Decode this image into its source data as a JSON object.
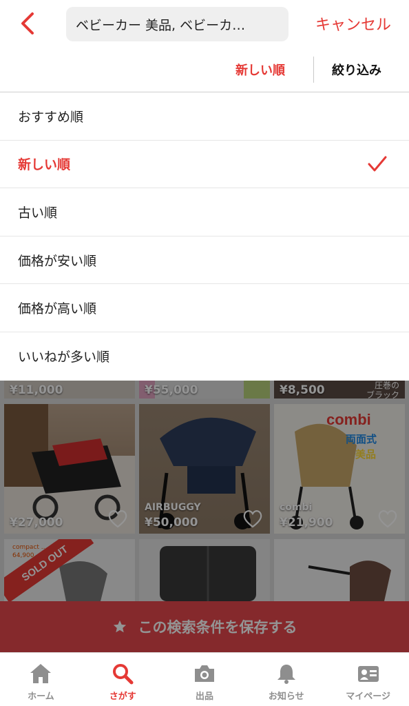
{
  "header": {
    "search_text": "ベビーカー 美品, ベビーカ…",
    "cancel_label": "キャンセル"
  },
  "sort_bar": {
    "active_sort_label": "新しい順",
    "filter_label": "絞り込み"
  },
  "sort_options": [
    {
      "label": "おすすめ順",
      "selected": false
    },
    {
      "label": "新しい順",
      "selected": true
    },
    {
      "label": "古い順",
      "selected": false
    },
    {
      "label": "価格が安い順",
      "selected": false
    },
    {
      "label": "価格が高い順",
      "selected": false
    },
    {
      "label": "いいねが多い順",
      "selected": false
    }
  ],
  "products": {
    "row1": [
      {
        "price": "¥11,000"
      },
      {
        "price": "¥55,000"
      },
      {
        "price": "¥8,500",
        "tag_line1": "圧巻の",
        "tag_line2": "ブラック"
      }
    ],
    "row2": [
      {
        "price": "¥27,000",
        "brand": ""
      },
      {
        "price": "¥50,000",
        "brand": "AIRBUGGY"
      },
      {
        "price": "¥21,900",
        "brand": "combi",
        "banner_word": "combi",
        "banner_line1": "両面式",
        "banner_line2": "美品"
      }
    ],
    "row3": [
      {
        "sold_label": "SOLD OUT",
        "tag_line1": "compact ...",
        "tag_line2": "64,900"
      },
      {},
      {}
    ]
  },
  "save_search": {
    "label": "この検索条件を保存する",
    "icon": "star-icon"
  },
  "bottom_nav": [
    {
      "label": "ホーム",
      "icon": "home-icon",
      "active": false
    },
    {
      "label": "さがす",
      "icon": "search-icon",
      "active": true
    },
    {
      "label": "出品",
      "icon": "camera-icon",
      "active": false
    },
    {
      "label": "お知らせ",
      "icon": "bell-icon",
      "active": false
    },
    {
      "label": "マイページ",
      "icon": "profile-card-icon",
      "active": false
    }
  ],
  "colors": {
    "accent": "#e53935",
    "save_bar": "#e5484d",
    "inactive_nav": "#8e8e8e"
  }
}
